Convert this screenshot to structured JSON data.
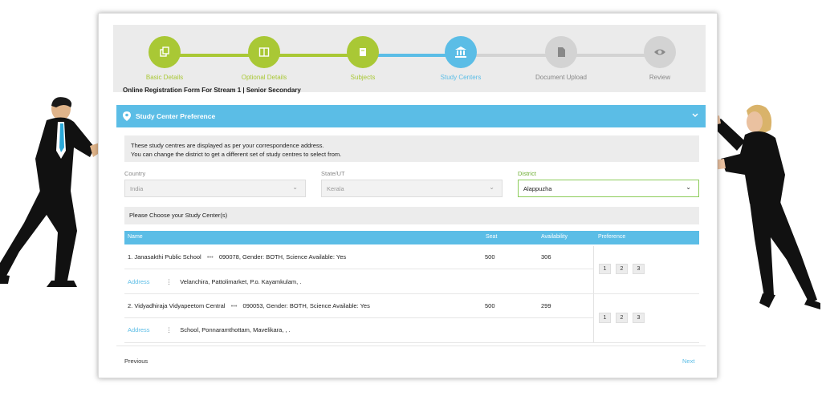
{
  "colors": {
    "done": "#a9c835",
    "active": "#5bbde6",
    "pending": "#d3d3d3",
    "link": "#5bbde6"
  },
  "stepper": {
    "steps": [
      {
        "label": "Basic Details",
        "icon": "copy-icon",
        "state": "done"
      },
      {
        "label": "Optional Details",
        "icon": "columns-icon",
        "state": "done"
      },
      {
        "label": "Subjects",
        "icon": "book-icon",
        "state": "done"
      },
      {
        "label": "Study Centers",
        "icon": "institution-icon",
        "state": "active"
      },
      {
        "label": "Document Upload",
        "icon": "document-icon",
        "state": "pending"
      },
      {
        "label": "Review",
        "icon": "eye-icon",
        "state": "pending"
      }
    ]
  },
  "form_title": "Online Registration Form For Stream 1 | Senior Secondary",
  "section": {
    "title": "Study Center Preference",
    "icon": "map-marker-icon"
  },
  "info": {
    "line1": "These study centres are displayed as per your correspondence address.",
    "line2": "You can change the district to get a different set of study centres to select from."
  },
  "filters": {
    "country": {
      "label": "Country",
      "value": "India"
    },
    "state": {
      "label": "State/UT",
      "value": "Kerala"
    },
    "district": {
      "label": "District",
      "value": "Alappuzha"
    }
  },
  "choose_label": "Please Choose your Study Center(s)",
  "table": {
    "headers": {
      "name": "Name",
      "seat": "Seat",
      "availability": "Availability",
      "preference": "Preference"
    },
    "rows": [
      {
        "name": "1. Janasakthi Public School",
        "sep": "•••",
        "details": "090078, Gender: BOTH, Science Available: Yes",
        "seat": "500",
        "availability": "306",
        "address_label": "Address",
        "address": "Velanchira, Pattolimarket, P.o. Kayamkulam, .",
        "prefs": [
          "1",
          "2",
          "3"
        ]
      },
      {
        "name": "2. Vidyadhiraja Vidyapeetom Central",
        "sep": "•••",
        "details": "090053, Gender: BOTH, Science Available: Yes",
        "seat": "500",
        "availability": "299",
        "address_label": "Address",
        "address": "School, Ponnaramthottam, Mavelikara, , .",
        "prefs": [
          "1",
          "2",
          "3"
        ]
      }
    ]
  },
  "nav": {
    "previous": "Previous",
    "next": "Next"
  }
}
